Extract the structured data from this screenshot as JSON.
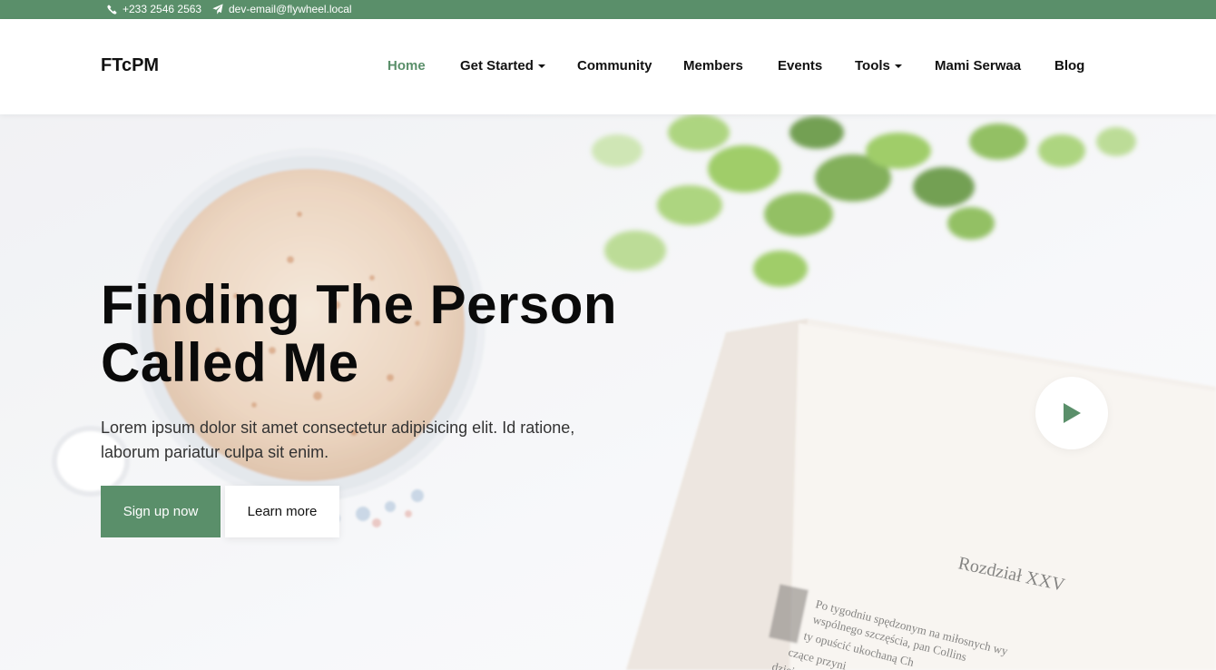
{
  "topbar": {
    "phone": "+233 2546 2563",
    "email": "dev-email@flywheel.local",
    "phone_icon": "phone-icon",
    "email_icon": "paper-plane-icon",
    "background": "#5a8f6a"
  },
  "header": {
    "brand": "FTcPM",
    "nav": [
      {
        "label": "Home",
        "active": true,
        "dropdown": false
      },
      {
        "label": "Get Started",
        "active": false,
        "dropdown": true
      },
      {
        "label": "Community",
        "active": false,
        "dropdown": false
      },
      {
        "label": "Members",
        "active": false,
        "dropdown": false
      },
      {
        "label": "Events",
        "active": false,
        "dropdown": false
      },
      {
        "label": "Tools",
        "active": false,
        "dropdown": true
      },
      {
        "label": "Mami Serwaa",
        "active": false,
        "dropdown": false
      },
      {
        "label": "Blog",
        "active": false,
        "dropdown": false
      }
    ]
  },
  "hero": {
    "title_line1": "Finding The Person",
    "title_line2": "Called Me",
    "description": "Lorem ipsum dolor sit amet consectetur adipisicing elit. Id ratione, laborum pariatur culpa sit enim.",
    "primary_button": "Sign up now",
    "secondary_button": "Learn more",
    "play_icon": "play-icon",
    "book_heading": "Rozdział XXV",
    "book_text": [
      "Po tygodniu spędzonym na miłosnych wy",
      "wspólnego szczęścia, pan Collins",
      "ty opuścić ukochaną Ch",
      "czące przyni",
      "dzięi"
    ]
  },
  "colors": {
    "accent": "#5a8f6a",
    "text": "#111111"
  }
}
